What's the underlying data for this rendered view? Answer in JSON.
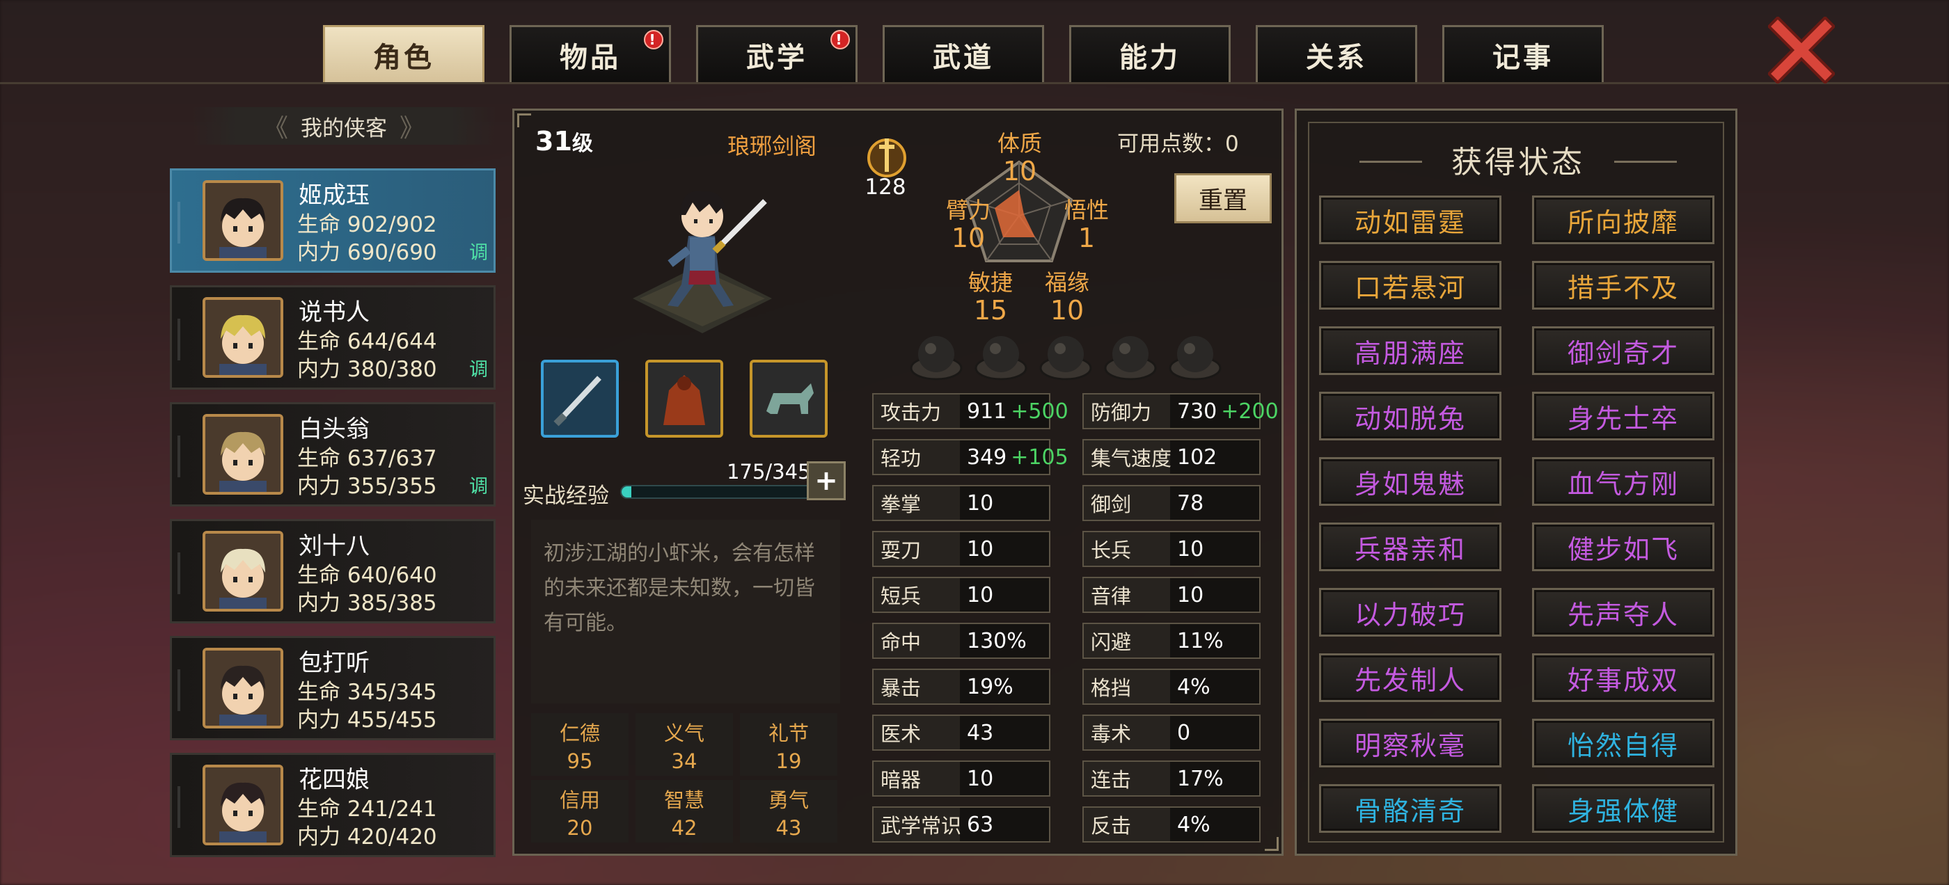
{
  "tabs": [
    {
      "label": "角色",
      "active": true,
      "badge": false
    },
    {
      "label": "物品",
      "active": false,
      "badge": true
    },
    {
      "label": "武学",
      "active": false,
      "badge": true
    },
    {
      "label": "武道",
      "active": false,
      "badge": false
    },
    {
      "label": "能力",
      "active": false,
      "badge": false
    },
    {
      "label": "关系",
      "active": false,
      "badge": false
    },
    {
      "label": "记事",
      "active": false,
      "badge": false
    }
  ],
  "badge_symbol": "!",
  "list_header": "我的侠客",
  "heroes": [
    {
      "name": "姬成珏",
      "hp_label": "生命",
      "hp": "902/902",
      "mp_label": "内力",
      "mp": "690/690",
      "tag": "调",
      "active": true
    },
    {
      "name": "说书人",
      "hp_label": "生命",
      "hp": "644/644",
      "mp_label": "内力",
      "mp": "380/380",
      "tag": "调",
      "active": false
    },
    {
      "name": "白头翁",
      "hp_label": "生命",
      "hp": "637/637",
      "mp_label": "内力",
      "mp": "355/355",
      "tag": "调",
      "active": false
    },
    {
      "name": "刘十八",
      "hp_label": "生命",
      "hp": "640/640",
      "mp_label": "内力",
      "mp": "385/385",
      "tag": "",
      "active": false
    },
    {
      "name": "包打听",
      "hp_label": "生命",
      "hp": "345/345",
      "mp_label": "内力",
      "mp": "455/455",
      "tag": "",
      "active": false
    },
    {
      "name": "花四娘",
      "hp_label": "生命",
      "hp": "241/241",
      "mp_label": "内力",
      "mp": "420/420",
      "tag": "",
      "active": false
    }
  ],
  "character": {
    "level": "31",
    "level_unit": "级",
    "sect": "琅琊剑阁",
    "power": "128",
    "points_label": "可用点数：",
    "points": "0",
    "reset_label": "重置",
    "attributes": [
      {
        "label": "体质",
        "value": "10"
      },
      {
        "label": "臂力",
        "value": "10"
      },
      {
        "label": "悟性",
        "value": "1"
      },
      {
        "label": "敏捷",
        "value": "15"
      },
      {
        "label": "福缘",
        "value": "10"
      }
    ],
    "exp_label": "实战经验",
    "exp_text": "175/3450",
    "exp_fraction": 0.05,
    "description": "初涉江湖的小虾米，会有怎样的未来还都是未知数，一切皆有可能。",
    "virtues": [
      {
        "label": "仁德",
        "value": "95"
      },
      {
        "label": "义气",
        "value": "34"
      },
      {
        "label": "礼节",
        "value": "19"
      },
      {
        "label": "信用",
        "value": "20"
      },
      {
        "label": "智慧",
        "value": "42"
      },
      {
        "label": "勇气",
        "value": "43"
      }
    ],
    "equipment_icons": [
      "sword-icon",
      "cloak-icon",
      "mount-icon"
    ]
  },
  "stats_left": [
    {
      "label": "攻击力",
      "value": "911",
      "bonus": "+500"
    },
    {
      "label": "轻功",
      "value": "349",
      "bonus": "+105"
    },
    {
      "label": "拳掌",
      "value": "10",
      "bonus": ""
    },
    {
      "label": "耍刀",
      "value": "10",
      "bonus": ""
    },
    {
      "label": "短兵",
      "value": "10",
      "bonus": ""
    },
    {
      "label": "命中",
      "value": "130%",
      "bonus": ""
    },
    {
      "label": "暴击",
      "value": "19%",
      "bonus": ""
    },
    {
      "label": "医术",
      "value": "43",
      "bonus": ""
    },
    {
      "label": "暗器",
      "value": "10",
      "bonus": ""
    },
    {
      "label": "武学常识",
      "value": "63",
      "bonus": ""
    }
  ],
  "stats_right": [
    {
      "label": "防御力",
      "value": "730",
      "bonus": "+200"
    },
    {
      "label": "集气速度",
      "value": "102",
      "bonus": ""
    },
    {
      "label": "御剑",
      "value": "78",
      "bonus": ""
    },
    {
      "label": "长兵",
      "value": "10",
      "bonus": ""
    },
    {
      "label": "音律",
      "value": "10",
      "bonus": ""
    },
    {
      "label": "闪避",
      "value": "11%",
      "bonus": ""
    },
    {
      "label": "格挡",
      "value": "4%",
      "bonus": ""
    },
    {
      "label": "毒术",
      "value": "0",
      "bonus": ""
    },
    {
      "label": "连击",
      "value": "17%",
      "bonus": ""
    },
    {
      "label": "反击",
      "value": "4%",
      "bonus": ""
    }
  ],
  "status_title": "获得状态",
  "statuses": [
    {
      "label": "动如雷霆",
      "color": "#e9a63a"
    },
    {
      "label": "所向披靡",
      "color": "#e9a63a"
    },
    {
      "label": "口若悬河",
      "color": "#e9a63a"
    },
    {
      "label": "措手不及",
      "color": "#e9a63a"
    },
    {
      "label": "高朋满座",
      "color": "#c45ae0"
    },
    {
      "label": "御剑奇才",
      "color": "#c45ae0"
    },
    {
      "label": "动如脱兔",
      "color": "#c45ae0"
    },
    {
      "label": "身先士卒",
      "color": "#c45ae0"
    },
    {
      "label": "身如鬼魅",
      "color": "#c45ae0"
    },
    {
      "label": "血气方刚",
      "color": "#c45ae0"
    },
    {
      "label": "兵器亲和",
      "color": "#c45ae0"
    },
    {
      "label": "健步如飞",
      "color": "#c45ae0"
    },
    {
      "label": "以力破巧",
      "color": "#c45ae0"
    },
    {
      "label": "先声夺人",
      "color": "#c45ae0"
    },
    {
      "label": "先发制人",
      "color": "#c45ae0"
    },
    {
      "label": "好事成双",
      "color": "#c45ae0"
    },
    {
      "label": "明察秋毫",
      "color": "#c45ae0"
    },
    {
      "label": "怡然自得",
      "color": "#2fb3e0"
    },
    {
      "label": "骨骼清奇",
      "color": "#2fb3e0"
    },
    {
      "label": "身强体健",
      "color": "#2fb3e0"
    }
  ],
  "colors": {
    "bonus": "#4cd464",
    "tag": "#4fe0a6",
    "attribute": "#f0a848",
    "active_tab": "#e6d6b0"
  }
}
